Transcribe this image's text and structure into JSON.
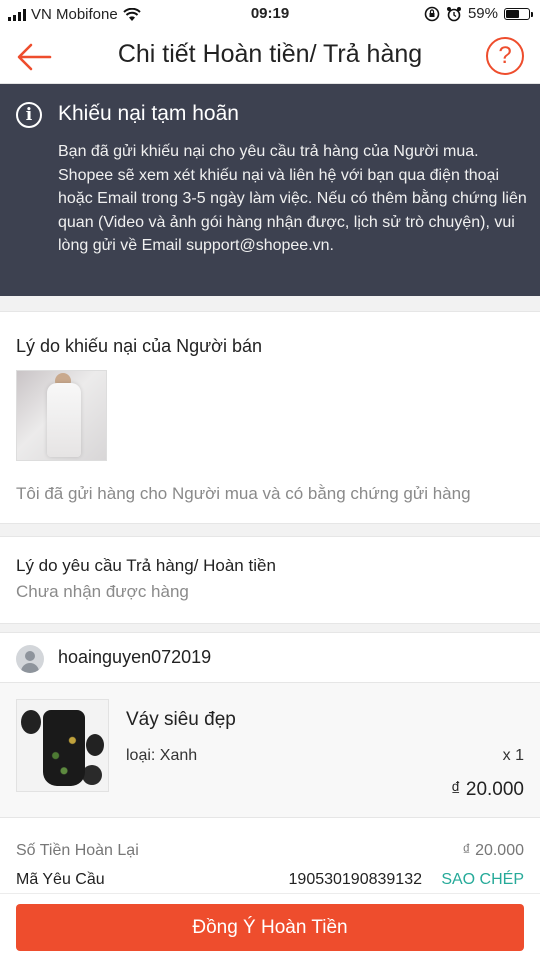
{
  "status_bar": {
    "carrier": "VN Mobifone",
    "time": "09:19",
    "battery_pct": "59%",
    "battery_level": 0.59
  },
  "header": {
    "title": "Chi tiết Hoàn tiền/ Trả hàng",
    "help_label": "?"
  },
  "banner": {
    "title": "Khiếu nại tạm hoãn",
    "text": "Bạn đã gửi khiếu nại cho yêu cầu trả hàng của Người mua. Shopee sẽ xem xét khiếu nại và liên hệ với bạn qua điện thoại hoặc Email trong 3-5 ngày làm việc. Nếu có thêm bằng chứng liên quan (Video và ảnh gói hàng nhận được, lịch sử trò chuyện), vui lòng gửi về Email support@shopee.vn."
  },
  "seller_complaint": {
    "title": "Lý do khiếu nại của Người bán",
    "reason": "Tôi đã gửi hàng cho Người mua và có bằng chứng gửi hàng"
  },
  "return_request": {
    "title": "Lý do yêu cầu Trả hàng/ Hoàn tiền",
    "reason": "Chưa nhận được hàng"
  },
  "buyer": {
    "username": "hoainguyen072019"
  },
  "product": {
    "name": "Váy siêu đẹp",
    "variant": "loại: Xanh",
    "quantity": "x 1",
    "price": "₫ 20.000"
  },
  "summary": {
    "refund_label": "Số Tiền Hoàn Lại",
    "refund_value": "₫ 20.000",
    "request_label": "Mã Yêu Cầu",
    "request_value": "190530190839132",
    "copy_label": "SAO CHÉP"
  },
  "footer": {
    "agree_label": "Đồng Ý Hoàn Tiền"
  },
  "colors": {
    "accent": "#ee4d2d",
    "banner_bg": "#3d4150",
    "copy_link": "#26aa99"
  }
}
